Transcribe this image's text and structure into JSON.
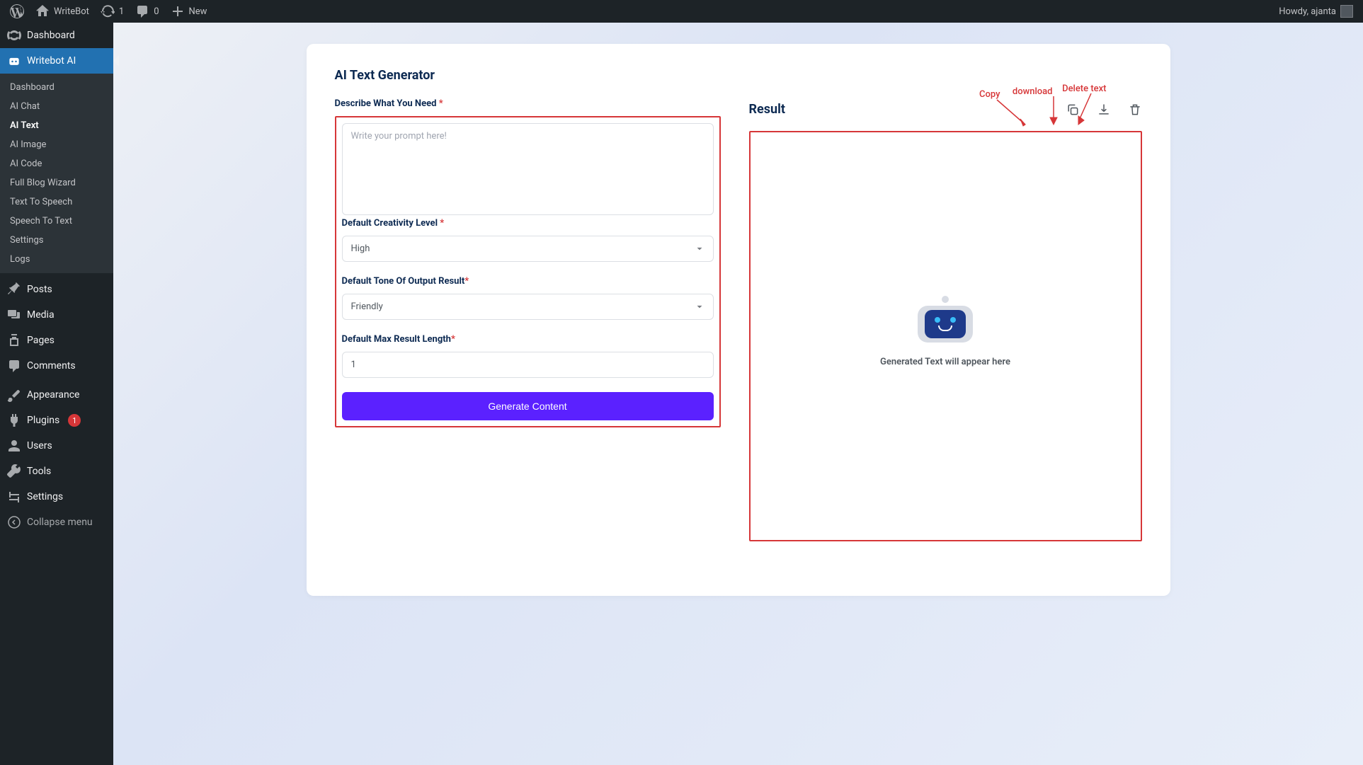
{
  "adminbar": {
    "site_name": "WriteBot",
    "updates": "1",
    "comments": "0",
    "new_label": "New",
    "howdy": "Howdy, ajanta"
  },
  "sidebar": {
    "dashboard": "Dashboard",
    "writebot": "Writebot AI",
    "submenu": [
      "Dashboard",
      "AI Chat",
      "AI Text",
      "AI Image",
      "AI Code",
      "Full Blog Wizard",
      "Text To Speech",
      "Speech To Text",
      "Settings",
      "Logs"
    ],
    "posts": "Posts",
    "media": "Media",
    "pages": "Pages",
    "comments": "Comments",
    "appearance": "Appearance",
    "plugins": "Plugins",
    "plugins_badge": "1",
    "users": "Users",
    "tools": "Tools",
    "settings": "Settings",
    "collapse": "Collapse menu"
  },
  "page": {
    "title": "AI Text Generator",
    "label_describe": "Describe What You Need",
    "placeholder_prompt": "Write your prompt here!",
    "label_creativity": "Default Creativity Level",
    "creativity_value": "High",
    "label_tone": "Default Tone Of Output Result",
    "tone_value": "Friendly",
    "label_maxlen": "Default Max Result Length",
    "maxlen_value": "1",
    "button_generate": "Generate Content",
    "result_title": "Result",
    "result_placeholder": "Generated Text will appear here"
  },
  "annotations": {
    "copy": "Copy",
    "download": "download",
    "delete": "Delete text"
  }
}
